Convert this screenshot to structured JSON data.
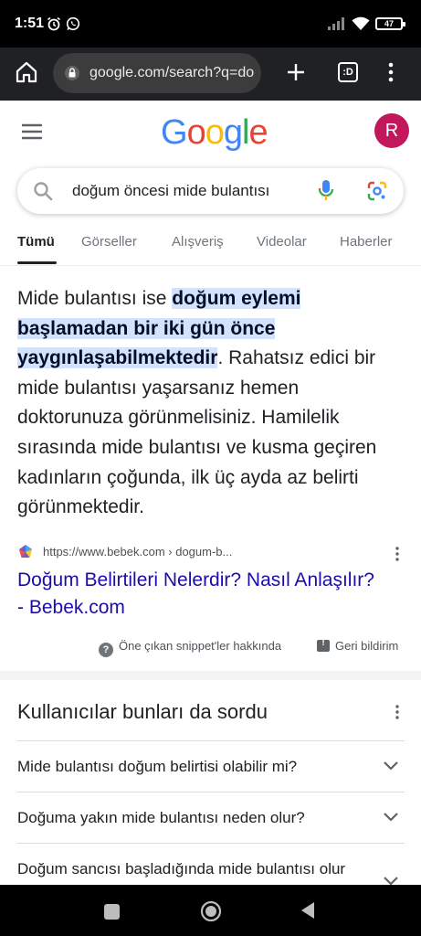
{
  "status_bar": {
    "time": "1:51",
    "battery": "47"
  },
  "browser": {
    "url": "google.com/search?q=do",
    "tab_count": ":D"
  },
  "google": {
    "logo_letters": [
      "G",
      "o",
      "o",
      "g",
      "l",
      "e"
    ],
    "logo_colors": [
      "#4285F4",
      "#EA4335",
      "#FBBC05",
      "#4285F4",
      "#34A853",
      "#EA4335"
    ],
    "avatar_letter": "R",
    "avatar_color": "#C2185B"
  },
  "search": {
    "query": "doğum öncesi mide bulantısı"
  },
  "tabs": [
    {
      "label": "Tümü",
      "active": true
    },
    {
      "label": "Görseller",
      "active": false
    },
    {
      "label": "Alışveriş",
      "active": false
    },
    {
      "label": "Videolar",
      "active": false
    },
    {
      "label": "Haberler",
      "active": false
    }
  ],
  "snippet": {
    "text_before": "Mide bulantısı ise ",
    "highlight": "doğum eylemi başlamadan bir iki gün önce yaygınlaşabilmektedir",
    "text_after": ". Rahatsız edici bir mide bulantısı yaşarsanız hemen doktorunuza görünmelisiniz. Hamilelik sırasında mide bulantısı ve kusma geçiren kadınların çoğunda, ilk üç ayda az belirti görünmektedir.",
    "source_url": "https://www.bebek.com › dogum-b...",
    "result_title": "Doğum Belirtileri Nelerdir? Nasıl Anlaşılır? - Bebek.com",
    "about_label": "Öne çıkan snippet'ler hakkında",
    "feedback_label": "Geri bildirim"
  },
  "people_also_ask": {
    "title": "Kullanıcılar bunları da sordu",
    "questions": [
      "Mide bulantısı doğum belirtisi olabilir mi?",
      "Doğuma yakın mide bulantısı neden olur?",
      "Doğum sancısı başladığında mide bulantısı olur"
    ]
  },
  "icons": {
    "status": [
      "alarm-icon",
      "whatsapp-icon",
      "signal-icon",
      "wifi-icon",
      "battery-icon"
    ],
    "toolbar": [
      "home-icon",
      "lock-icon",
      "plus-icon",
      "tabs-icon",
      "more-vert-icon"
    ],
    "search": [
      "search-icon",
      "mic-icon",
      "lens-icon"
    ],
    "nav": [
      "recents-icon",
      "home-icon",
      "back-icon"
    ]
  }
}
